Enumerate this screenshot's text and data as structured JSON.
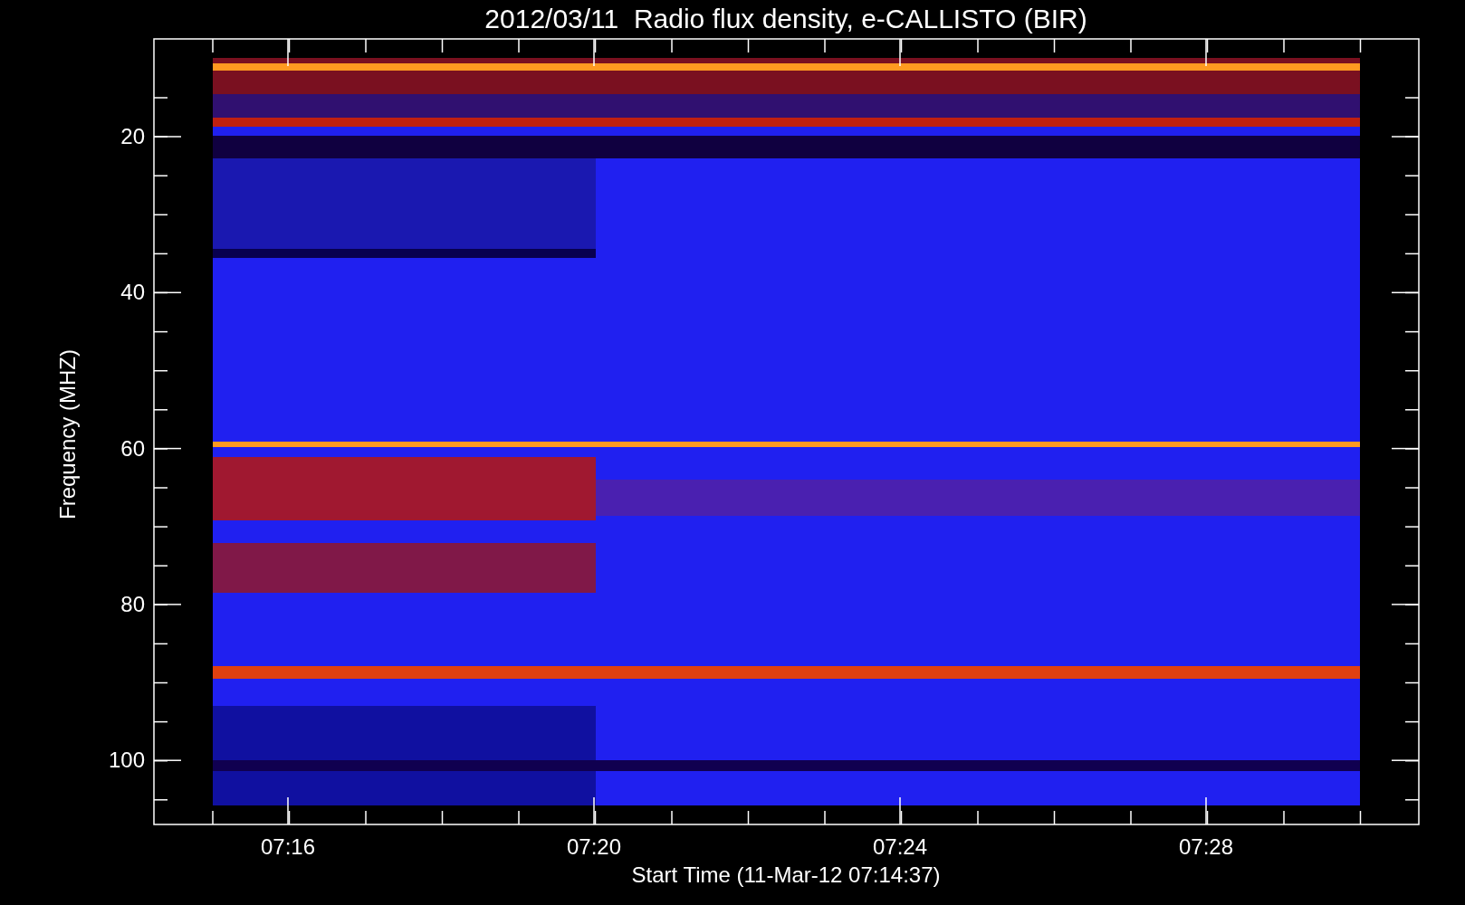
{
  "title": "2012/03/11  Radio flux density, e-CALLISTO (BIR)",
  "y_axis": {
    "label": "Frequency (MHZ)",
    "ticks": [
      "20",
      "40",
      "60",
      "80",
      "100"
    ]
  },
  "x_axis": {
    "label": "Start Time (11-Mar-12 07:14:37)",
    "ticks": [
      "07:16",
      "07:20",
      "07:24",
      "07:28"
    ]
  }
}
